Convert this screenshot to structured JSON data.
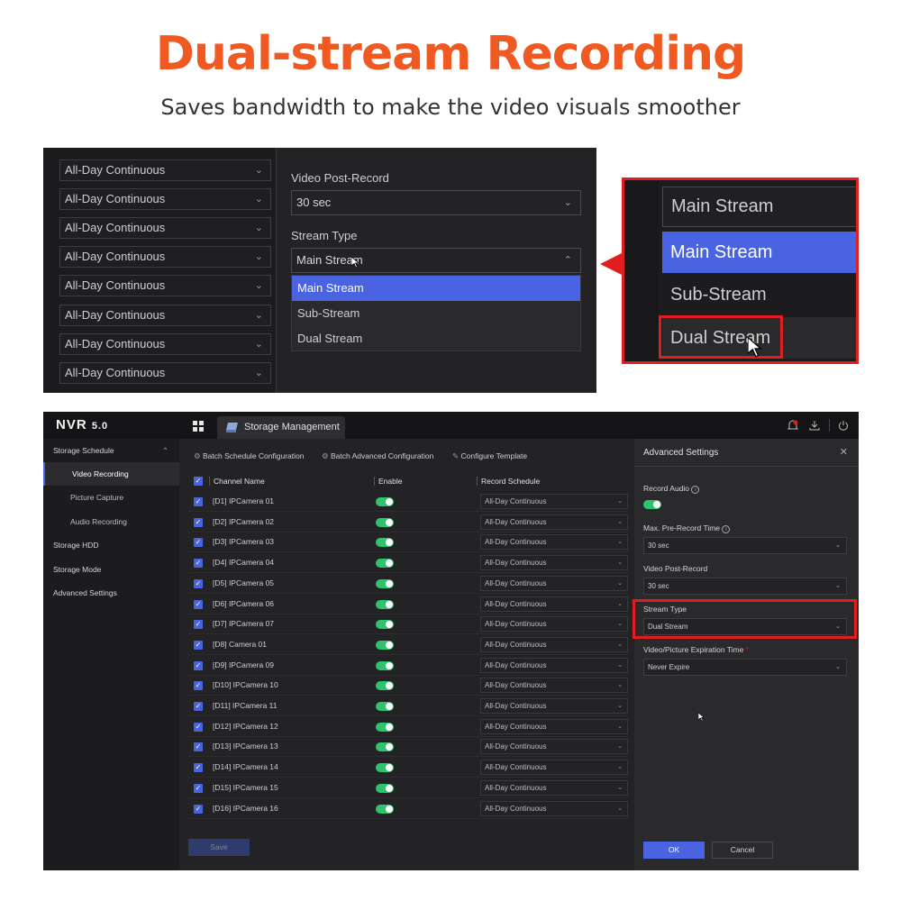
{
  "headline": "Dual-stream Recording",
  "subline": "Saves bandwidth to make the video visuals smoother",
  "panel1": {
    "schedules": [
      "All-Day Continuous",
      "All-Day Continuous",
      "All-Day Continuous",
      "All-Day Continuous",
      "All-Day Continuous",
      "All-Day Continuous",
      "All-Day Continuous",
      "All-Day Continuous"
    ],
    "post_record_label": "Video Post-Record",
    "post_record_value": "30 sec",
    "stream_type_label": "Stream Type",
    "stream_type_value": "Main Stream",
    "options": [
      "Main Stream",
      "Sub-Stream",
      "Dual Stream"
    ]
  },
  "zoom": {
    "selected_value": "Main Stream",
    "options": [
      "Main Stream",
      "Sub-Stream",
      "Dual Stream"
    ]
  },
  "nvr": {
    "logo": "NVR",
    "logo_version": "5.0",
    "tab": "Storage Management",
    "sidebar": {
      "group": "Storage Schedule",
      "items": [
        "Video Recording",
        "Picture Capture",
        "Audio Recording"
      ],
      "sections": [
        "Storage HDD",
        "Storage Mode",
        "Advanced Settings"
      ]
    },
    "toolbar": {
      "batch_schedule": "Batch Schedule Configuration",
      "batch_advanced": "Batch Advanced Configuration",
      "configure_template": "Configure Template"
    },
    "columns": {
      "channel": "Channel Name",
      "enable": "Enable",
      "schedule": "Record Schedule"
    },
    "rows": [
      {
        "name": "[D1] IPCamera 01",
        "schedule": "All-Day Continuous"
      },
      {
        "name": "[D2] IPCamera 02",
        "schedule": "All-Day Continuous"
      },
      {
        "name": "[D3] IPCamera 03",
        "schedule": "All-Day Continuous"
      },
      {
        "name": "[D4] IPCamera 04",
        "schedule": "All-Day Continuous"
      },
      {
        "name": "[D5] IPCamera 05",
        "schedule": "All-Day Continuous"
      },
      {
        "name": "[D6] IPCamera 06",
        "schedule": "All-Day Continuous"
      },
      {
        "name": "[D7] IPCamera 07",
        "schedule": "All-Day Continuous"
      },
      {
        "name": "[D8] Camera 01",
        "schedule": "All-Day Continuous"
      },
      {
        "name": "[D9] IPCamera 09",
        "schedule": "All-Day Continuous"
      },
      {
        "name": "[D10] IPCamera 10",
        "schedule": "All-Day Continuous"
      },
      {
        "name": "[D11] IPCamera 11",
        "schedule": "All-Day Continuous"
      },
      {
        "name": "[D12] IPCamera 12",
        "schedule": "All-Day Continuous"
      },
      {
        "name": "[D13] IPCamera 13",
        "schedule": "All-Day Continuous"
      },
      {
        "name": "[D14] IPCamera 14",
        "schedule": "All-Day Continuous"
      },
      {
        "name": "[D15] IPCamera 15",
        "schedule": "All-Day Continuous"
      },
      {
        "name": "[D16] IPCamera 16",
        "schedule": "All-Day Continuous"
      }
    ],
    "save": "Save",
    "advanced": {
      "title": "Advanced Settings",
      "record_audio": "Record Audio",
      "max_pre_record": "Max. Pre-Record Time",
      "max_pre_record_value": "30 sec",
      "post_record": "Video Post-Record",
      "post_record_value": "30 sec",
      "stream_type": "Stream Type",
      "stream_type_value": "Dual Stream",
      "expiration": "Video/Picture Expiration Time",
      "expiration_value": "Never Expire",
      "ok": "OK",
      "cancel": "Cancel"
    }
  },
  "colors": {
    "accent": "#4a63e0",
    "brand": "#f05a22",
    "highlight": "#e01e1e",
    "toggle_on": "#2fc36b"
  }
}
